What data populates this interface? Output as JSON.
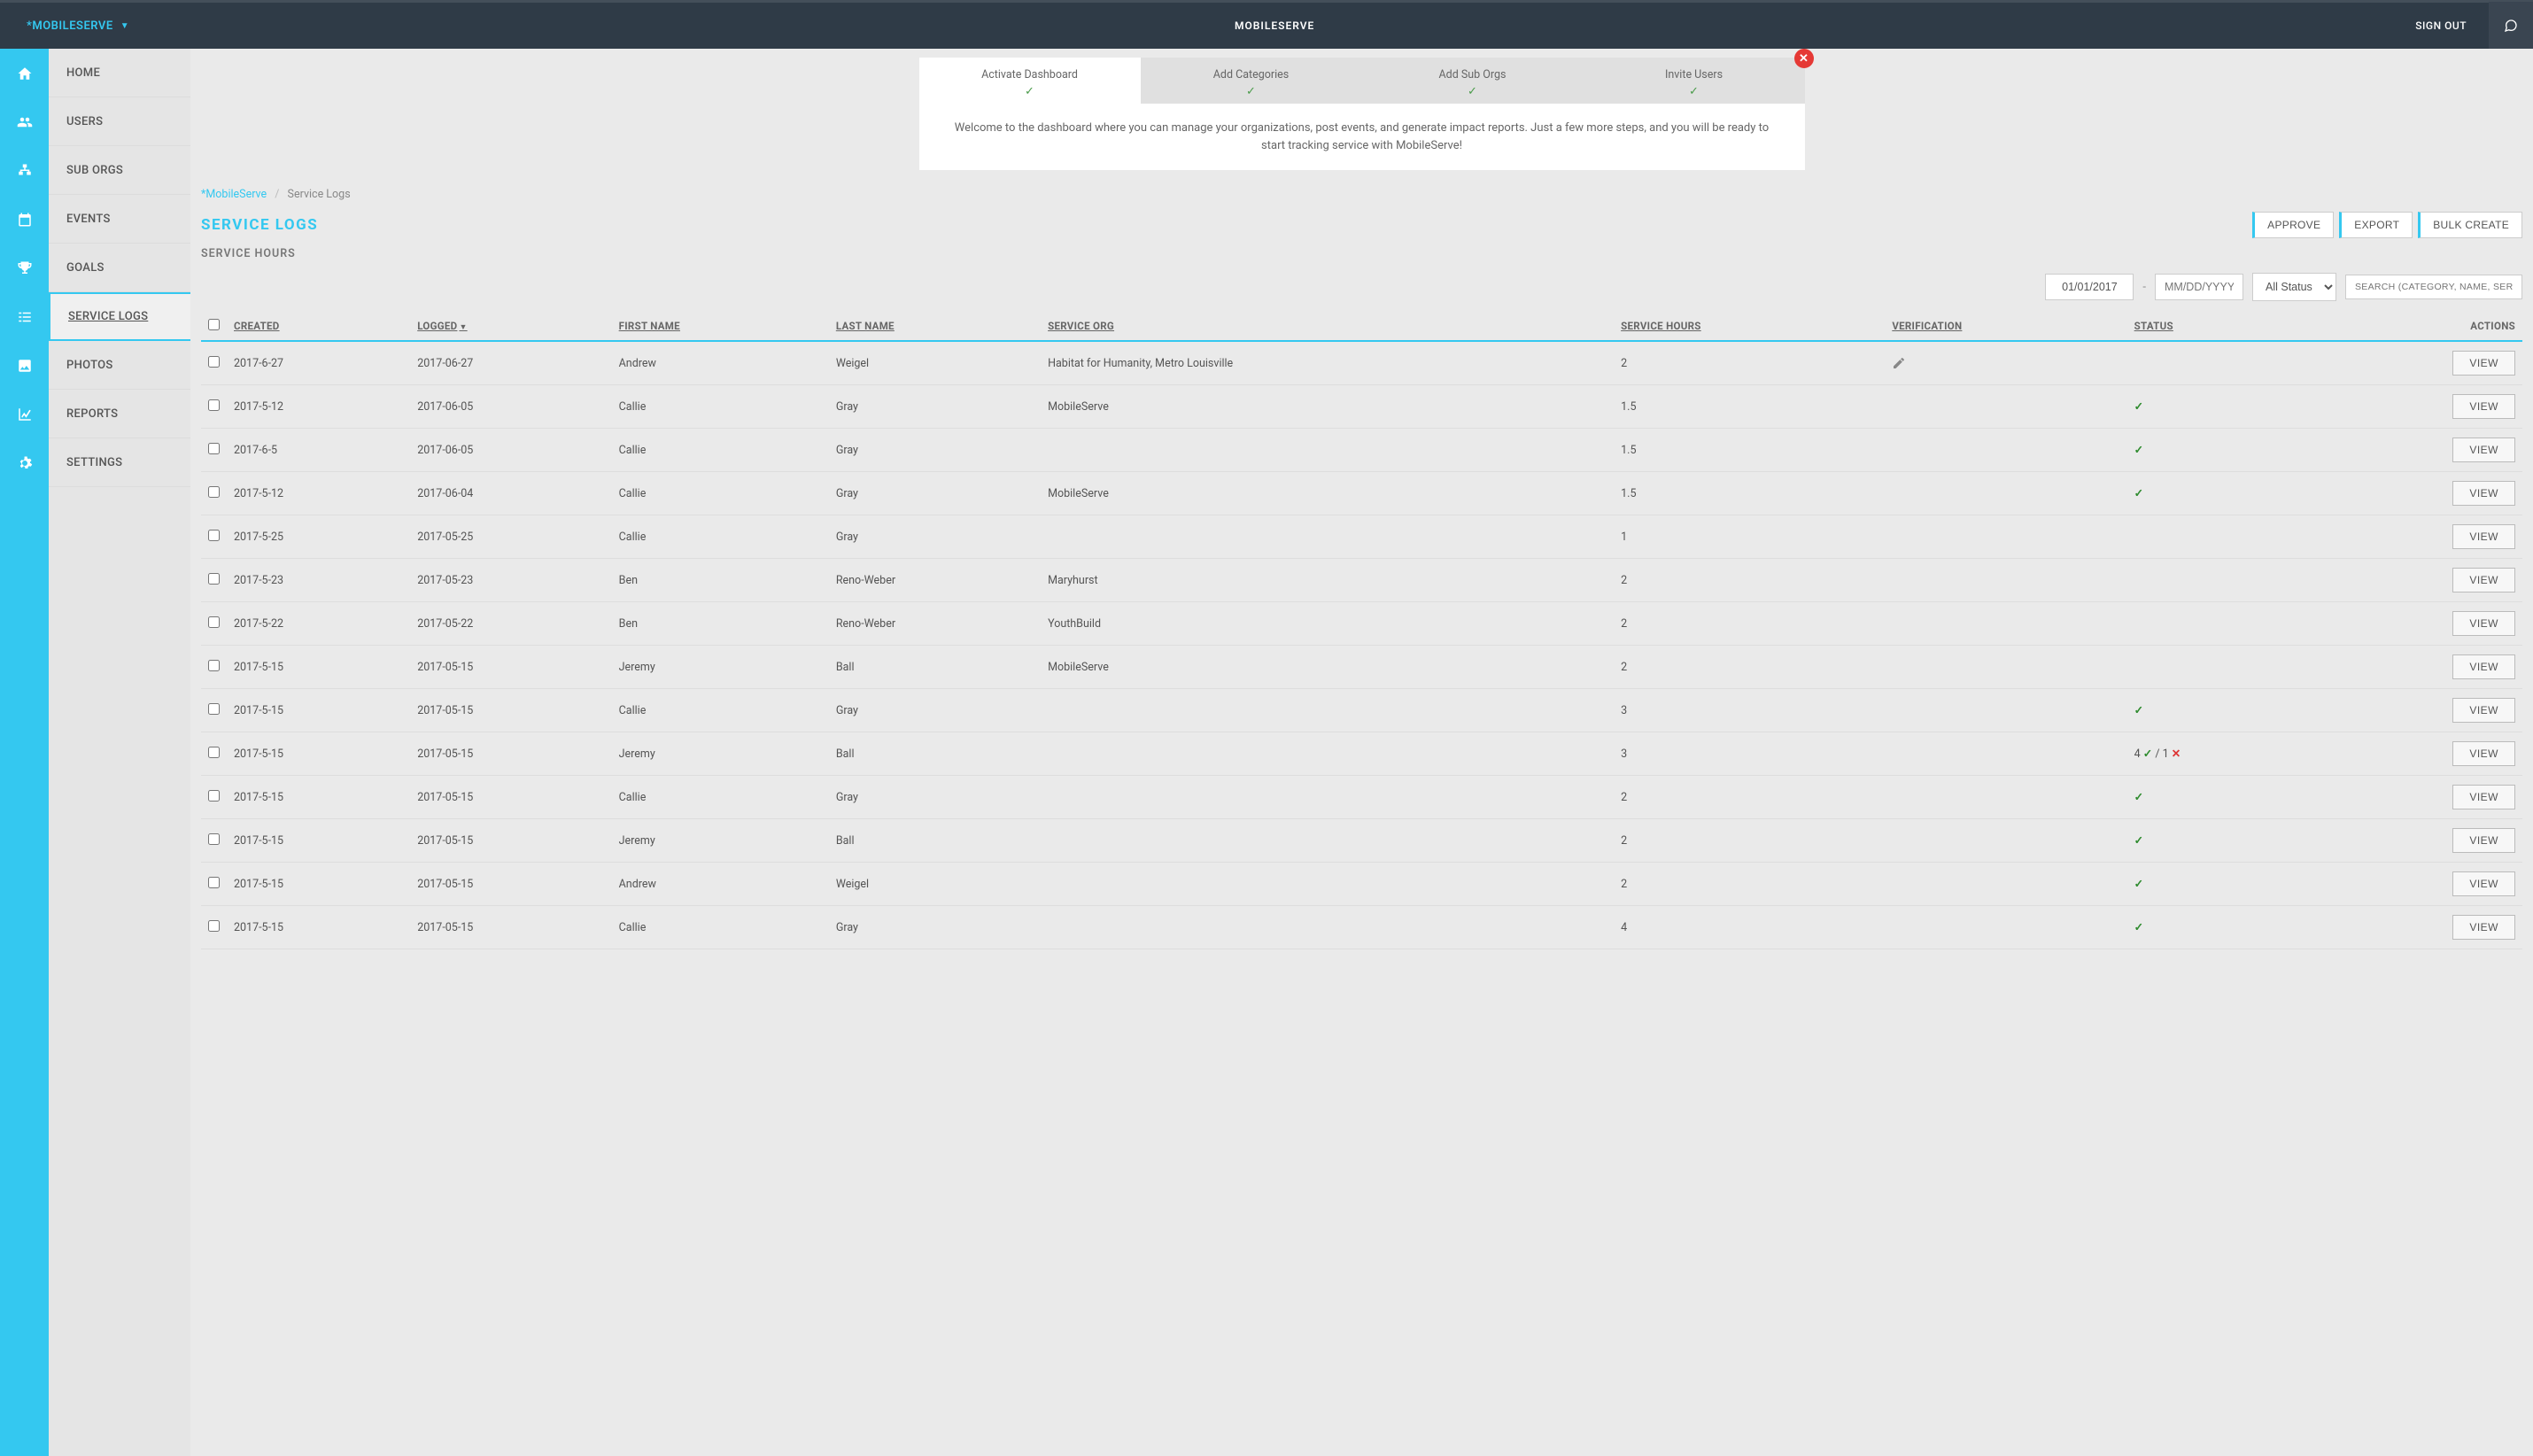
{
  "topbar": {
    "org_label": "*MOBILESERVE",
    "app_title": "MOBILESERVE",
    "signout": "SIGN OUT"
  },
  "sidebar": {
    "items": [
      {
        "label": "HOME",
        "icon": "home"
      },
      {
        "label": "USERS",
        "icon": "users"
      },
      {
        "label": "SUB ORGS",
        "icon": "sitemap"
      },
      {
        "label": "EVENTS",
        "icon": "calendar"
      },
      {
        "label": "GOALS",
        "icon": "trophy"
      },
      {
        "label": "SERVICE LOGS",
        "icon": "list"
      },
      {
        "label": "PHOTOS",
        "icon": "image"
      },
      {
        "label": "REPORTS",
        "icon": "chart"
      },
      {
        "label": "SETTINGS",
        "icon": "cog"
      }
    ],
    "active_index": 5
  },
  "banner": {
    "steps": [
      {
        "label": "Activate Dashboard",
        "done": true,
        "active": true
      },
      {
        "label": "Add Categories",
        "done": true,
        "active": false
      },
      {
        "label": "Add Sub Orgs",
        "done": true,
        "active": false
      },
      {
        "label": "Invite Users",
        "done": true,
        "active": false
      }
    ],
    "text": "Welcome to the dashboard where you can manage your organizations, post events, and generate impact reports. Just a few more steps, and you will be ready to start tracking service with MobileServe!"
  },
  "breadcrumb": {
    "root": "*MobileServe",
    "current": "Service Logs"
  },
  "page": {
    "title": "SERVICE LOGS",
    "subtitle": "SERVICE HOURS",
    "buttons": {
      "approve": "APPROVE",
      "export": "EXPORT",
      "bulk": "BULK CREATE"
    }
  },
  "filters": {
    "date_from": "01/01/2017",
    "date_to_placeholder": "MM/DD/YYYY",
    "status_select": "All Statuses",
    "search_placeholder": "SEARCH (CATEGORY, NAME, SERVICE ORG"
  },
  "table": {
    "headers": {
      "created": "CREATED",
      "logged": "LOGGED",
      "first": "FIRST NAME",
      "last": "LAST NAME",
      "org": "SERVICE ORG",
      "hours": "SERVICE HOURS",
      "verification": "VERIFICATION",
      "status": "STATUS",
      "actions": "ACTIONS"
    },
    "view_label": "VIEW",
    "rows": [
      {
        "created": "2017-6-27",
        "logged": "2017-06-27",
        "first": "Andrew",
        "last": "Weigel",
        "org": "Habitat for Humanity, Metro Louisville",
        "hours": "2",
        "verification": "pencil",
        "status": ""
      },
      {
        "created": "2017-5-12",
        "logged": "2017-06-05",
        "first": "Callie",
        "last": "Gray",
        "org": "MobileServe",
        "hours": "1.5",
        "verification": "",
        "status": "check"
      },
      {
        "created": "2017-6-5",
        "logged": "2017-06-05",
        "first": "Callie",
        "last": "Gray",
        "org": "",
        "hours": "1.5",
        "verification": "",
        "status": "check"
      },
      {
        "created": "2017-5-12",
        "logged": "2017-06-04",
        "first": "Callie",
        "last": "Gray",
        "org": "MobileServe",
        "hours": "1.5",
        "verification": "",
        "status": "check"
      },
      {
        "created": "2017-5-25",
        "logged": "2017-05-25",
        "first": "Callie",
        "last": "Gray",
        "org": "",
        "hours": "1",
        "verification": "",
        "status": ""
      },
      {
        "created": "2017-5-23",
        "logged": "2017-05-23",
        "first": "Ben",
        "last": "Reno-Weber",
        "org": "Maryhurst",
        "hours": "2",
        "verification": "",
        "status": ""
      },
      {
        "created": "2017-5-22",
        "logged": "2017-05-22",
        "first": "Ben",
        "last": "Reno-Weber",
        "org": "YouthBuild",
        "hours": "2",
        "verification": "",
        "status": ""
      },
      {
        "created": "2017-5-15",
        "logged": "2017-05-15",
        "first": "Jeremy",
        "last": "Ball",
        "org": "MobileServe",
        "hours": "2",
        "verification": "",
        "status": ""
      },
      {
        "created": "2017-5-15",
        "logged": "2017-05-15",
        "first": "Callie",
        "last": "Gray",
        "org": "",
        "hours": "3",
        "verification": "",
        "status": "check"
      },
      {
        "created": "2017-5-15",
        "logged": "2017-05-15",
        "first": "Jeremy",
        "last": "Ball",
        "org": "",
        "hours": "3",
        "verification": "",
        "status": "4/1"
      },
      {
        "created": "2017-5-15",
        "logged": "2017-05-15",
        "first": "Callie",
        "last": "Gray",
        "org": "",
        "hours": "2",
        "verification": "",
        "status": "check"
      },
      {
        "created": "2017-5-15",
        "logged": "2017-05-15",
        "first": "Jeremy",
        "last": "Ball",
        "org": "",
        "hours": "2",
        "verification": "",
        "status": "check"
      },
      {
        "created": "2017-5-15",
        "logged": "2017-05-15",
        "first": "Andrew",
        "last": "Weigel",
        "org": "",
        "hours": "2",
        "verification": "",
        "status": "check"
      },
      {
        "created": "2017-5-15",
        "logged": "2017-05-15",
        "first": "Callie",
        "last": "Gray",
        "org": "",
        "hours": "4",
        "verification": "",
        "status": "check"
      }
    ]
  }
}
